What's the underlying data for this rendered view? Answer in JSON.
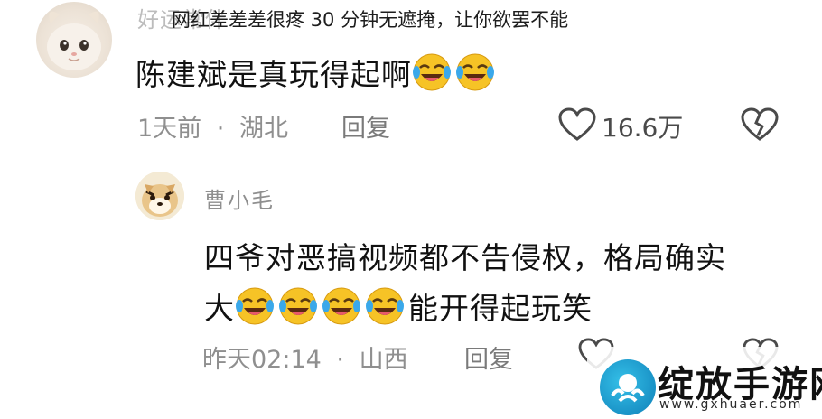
{
  "overlay_caption": "网红差差差很疼 30 分钟无遮掩，让你欲罢不能",
  "comments": [
    {
      "username": "好运常伴",
      "text": "陈建斌是真玩得起啊",
      "emoji_icon": "laughing-crying-emoji",
      "emoji_count": 2,
      "time": "1天前",
      "separator": "·",
      "location": "湖北",
      "reply_label": "回复",
      "likes": "16.6万",
      "like_icon": "heart-outline-icon",
      "dislike_icon": "broken-heart-icon"
    }
  ],
  "reply": {
    "username": "曹小毛",
    "text_line1": "四爷对恶搞视频都不告侵权，格局确实",
    "text_line2_prefix": "大",
    "text_line2_suffix": "能开得起玩笑",
    "emoji_count": 4,
    "time": "昨天02:14",
    "separator": "·",
    "location": "山西",
    "reply_label": "回复"
  },
  "watermark": {
    "name": "绽放手游网",
    "url": "www.gxhuaer.com",
    "brand_color": "#1b9ad6"
  }
}
